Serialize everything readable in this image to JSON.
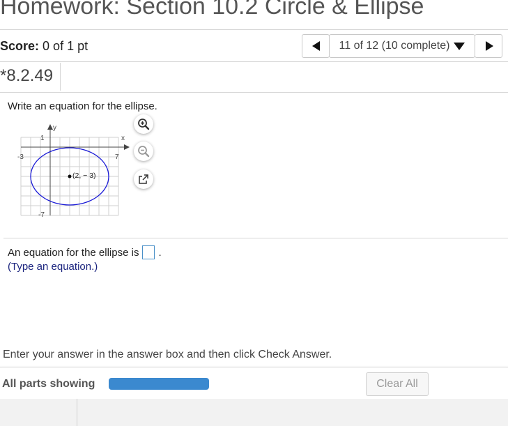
{
  "header": {
    "title": "Homework: Section 10.2 Circle & Ellipse"
  },
  "score": {
    "label": "Score:",
    "value": "0 of 1 pt"
  },
  "nav": {
    "position": "11 of 12 (10 complete)"
  },
  "question": {
    "number": "*8.2.49",
    "prompt": "Write an equation for the ellipse.",
    "answer_prefix": "An equation for the ellipse is",
    "answer_suffix": ".",
    "hint": "(Type an equation.)"
  },
  "graph": {
    "axis_x_label": "x",
    "axis_y_label": "y",
    "tick_y_top": "1",
    "tick_x_left": "-3",
    "tick_x_right": "7",
    "tick_y_bottom": "-7",
    "center_label": "(2, − 3)",
    "center": [
      2,
      -3
    ],
    "x_range": [
      -3,
      7
    ],
    "y_range": [
      -7,
      1
    ],
    "ellipse_color": "#1a1ad6"
  },
  "tools": {
    "zoom_in": "zoom-in-icon",
    "zoom_out": "zoom-out-icon",
    "popout": "popout-icon"
  },
  "footer": {
    "instructions": "Enter your answer in the answer box and then click Check Answer.",
    "parts": "All parts showing",
    "progress": 1.0,
    "clear_label": "Clear All"
  }
}
